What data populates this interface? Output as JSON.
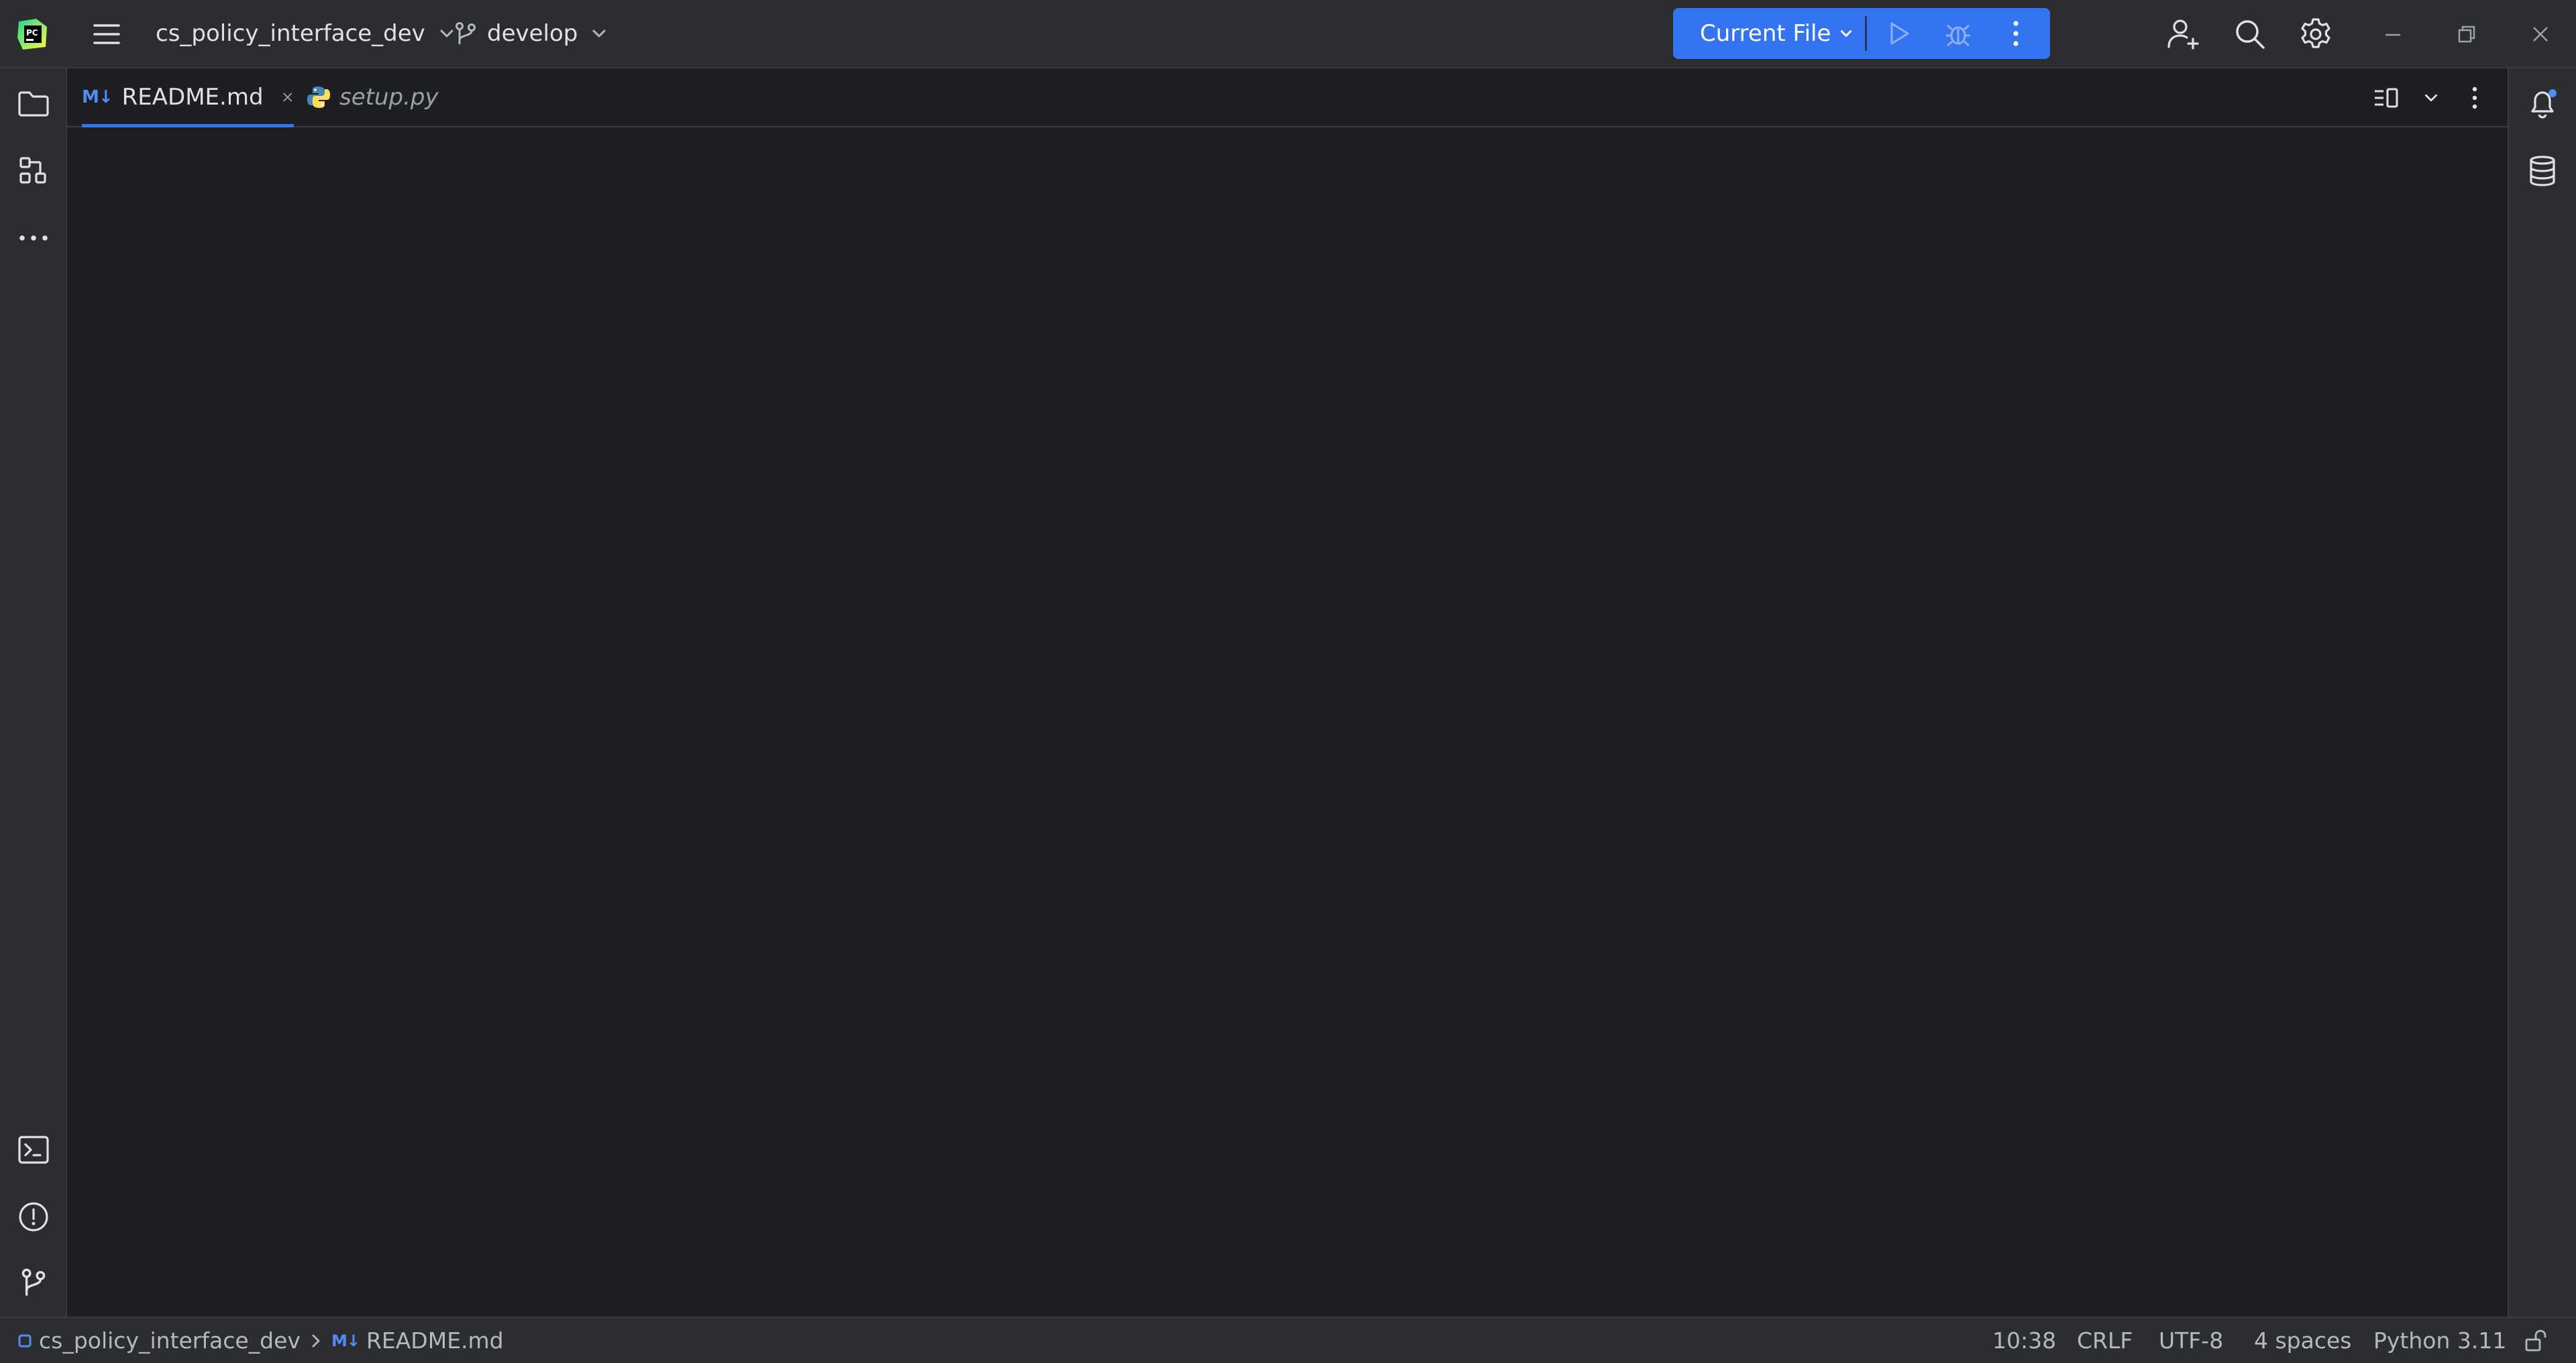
{
  "titlebar": {
    "project_name": "cs_policy_interface_dev",
    "branch": "develop",
    "run_config": "Current File",
    "icons": {
      "app": "pycharm-logo-icon",
      "menu": "hamburger-menu-icon",
      "branch": "git-branch-icon",
      "run": "run-play-icon",
      "debug": "debug-bug-icon",
      "more": "more-vertical-icon",
      "code_with_me": "add-user-icon",
      "search": "search-icon",
      "settings": "gear-icon",
      "minimize": "minimize-icon",
      "restore": "restore-icon",
      "close": "close-icon"
    }
  },
  "left_toolbar": {
    "icons": [
      "folder-icon",
      "structure-icon",
      "more-horizontal-icon",
      "terminal-icon",
      "problems-icon",
      "git-branch-icon"
    ]
  },
  "right_toolbar": {
    "icons": [
      "notifications-icon",
      "database-icon"
    ]
  },
  "tabs": [
    {
      "badge": "M↓",
      "label": "README.md",
      "active": true,
      "closable": true
    },
    {
      "label": "setup.py",
      "active": false,
      "preview": true,
      "icon": "python-icon"
    }
  ],
  "statusbar": {
    "project": "cs_policy_interface_dev",
    "file_badge": "M↓",
    "file": "README.md",
    "position": "10:38",
    "line_separator": "CRLF",
    "encoding": "UTF-8",
    "indent": "4 spaces",
    "interpreter": "Python 3.11"
  },
  "colors": {
    "accent": "#3574f0",
    "background": "#1e1f22",
    "panel": "#2b2d30",
    "markdown_badge": "#548af7",
    "notification_dot": "#548af7"
  }
}
